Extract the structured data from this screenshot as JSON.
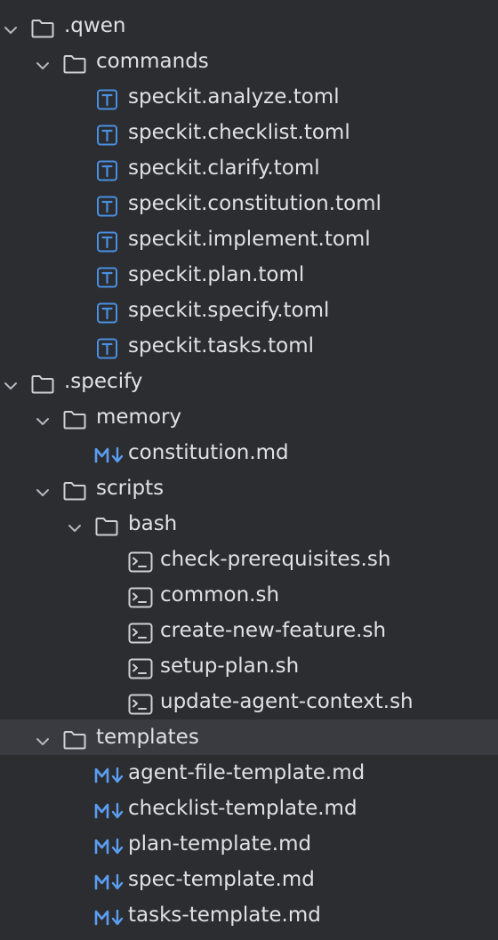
{
  "tree": [
    {
      "kind": "folder",
      "depth": 0,
      "label": ".qwen",
      "expanded": true
    },
    {
      "kind": "folder",
      "depth": 1,
      "label": "commands",
      "expanded": true
    },
    {
      "kind": "toml",
      "depth": 2,
      "label": "speckit.analyze.toml",
      "icon": "toml-file-icon"
    },
    {
      "kind": "toml",
      "depth": 2,
      "label": "speckit.checklist.toml",
      "icon": "toml-file-icon"
    },
    {
      "kind": "toml",
      "depth": 2,
      "label": "speckit.clarify.toml",
      "icon": "toml-file-icon"
    },
    {
      "kind": "toml",
      "depth": 2,
      "label": "speckit.constitution.toml",
      "icon": "toml-file-icon"
    },
    {
      "kind": "toml",
      "depth": 2,
      "label": "speckit.implement.toml",
      "icon": "toml-file-icon"
    },
    {
      "kind": "toml",
      "depth": 2,
      "label": "speckit.plan.toml",
      "icon": "toml-file-icon"
    },
    {
      "kind": "toml",
      "depth": 2,
      "label": "speckit.specify.toml",
      "icon": "toml-file-icon"
    },
    {
      "kind": "toml",
      "depth": 2,
      "label": "speckit.tasks.toml",
      "icon": "toml-file-icon"
    },
    {
      "kind": "folder",
      "depth": 0,
      "label": ".specify",
      "expanded": true
    },
    {
      "kind": "folder",
      "depth": 1,
      "label": "memory",
      "expanded": true
    },
    {
      "kind": "md",
      "depth": 2,
      "label": "constitution.md",
      "icon": "markdown-file-icon"
    },
    {
      "kind": "folder",
      "depth": 1,
      "label": "scripts",
      "expanded": true
    },
    {
      "kind": "folder",
      "depth": 2,
      "label": "bash",
      "expanded": true
    },
    {
      "kind": "sh",
      "depth": 3,
      "label": "check-prerequisites.sh",
      "icon": "shell-script-icon"
    },
    {
      "kind": "sh",
      "depth": 3,
      "label": "common.sh",
      "icon": "shell-script-icon"
    },
    {
      "kind": "sh",
      "depth": 3,
      "label": "create-new-feature.sh",
      "icon": "shell-script-icon"
    },
    {
      "kind": "sh",
      "depth": 3,
      "label": "setup-plan.sh",
      "icon": "shell-script-icon"
    },
    {
      "kind": "sh",
      "depth": 3,
      "label": "update-agent-context.sh",
      "icon": "shell-script-icon"
    },
    {
      "kind": "folder",
      "depth": 1,
      "label": "templates",
      "expanded": true,
      "selected": true
    },
    {
      "kind": "md",
      "depth": 2,
      "label": "agent-file-template.md",
      "icon": "markdown-file-icon"
    },
    {
      "kind": "md",
      "depth": 2,
      "label": "checklist-template.md",
      "icon": "markdown-file-icon"
    },
    {
      "kind": "md",
      "depth": 2,
      "label": "plan-template.md",
      "icon": "markdown-file-icon"
    },
    {
      "kind": "md",
      "depth": 2,
      "label": "spec-template.md",
      "icon": "markdown-file-icon"
    },
    {
      "kind": "md",
      "depth": 2,
      "label": "tasks-template.md",
      "icon": "markdown-file-icon"
    }
  ],
  "colors": {
    "background": "#2b2d30",
    "selected_row": "#393b40",
    "text": "#dfe1e5",
    "folder_outline": "#ced0d6",
    "chevron": "#b4b8bf",
    "toml_icon": "#4a90e2",
    "markdown_icon": "#5b9df0",
    "shell_icon": "#ced0d6"
  }
}
